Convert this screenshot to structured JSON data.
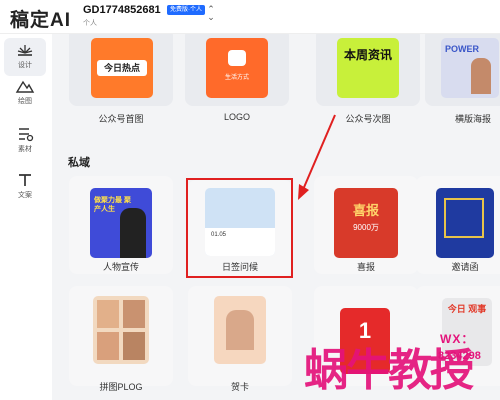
{
  "header": {
    "logo": "稿定AI",
    "account_id": "GD1774852681",
    "account_badge": "免费版·个人",
    "account_type": "个人"
  },
  "sidebar": {
    "items": [
      {
        "label": "设计",
        "icon": "design-icon",
        "active": true
      },
      {
        "label": "绘图",
        "icon": "draw-icon",
        "active": false
      },
      {
        "label": "素材",
        "icon": "material-icon",
        "active": false
      },
      {
        "label": "文案",
        "icon": "text-icon",
        "active": false
      }
    ]
  },
  "main": {
    "top_row": [
      {
        "label": "公众号首图",
        "thumb_text": "今日热点"
      },
      {
        "label": "LOGO",
        "thumb_text": "生活方式"
      },
      {
        "label": "公众号次图",
        "thumb_text": "本周资讯"
      },
      {
        "label": "横版海报",
        "thumb_text": "POWER"
      }
    ],
    "section_title": "私域",
    "private_row": [
      {
        "label": "人物宣传",
        "thumb_text": "做聚力最 聚产人生"
      },
      {
        "label": "日签问候",
        "thumb_text": "01.05"
      },
      {
        "label": "喜报",
        "thumb_text": "喜报",
        "thumb_sub": "9000万"
      },
      {
        "label": "邀请函",
        "thumb_text": ""
      }
    ],
    "bottom_row": [
      {
        "label": "拼图PLOG"
      },
      {
        "label": "贺卡"
      },
      {
        "label": "",
        "thumb_text": "1"
      },
      {
        "label": "",
        "thumb_text": "今日 观事"
      }
    ]
  },
  "watermark": {
    "line1": "WX：",
    "line2": "8234298",
    "brand": "蜗牛教授"
  },
  "colors": {
    "accent": "#e02020",
    "badge": "#1f6bff",
    "watermark": "#e4137b"
  }
}
